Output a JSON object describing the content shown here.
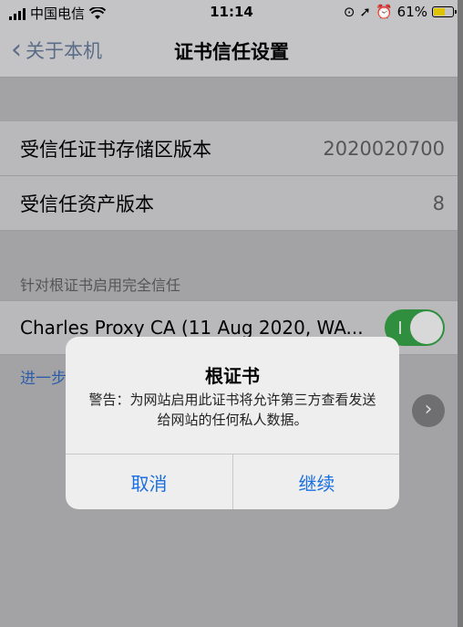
{
  "status_bar": {
    "carrier": "中国电信",
    "time": "11:14",
    "battery_percent": "61%",
    "battery_level": 0.61,
    "icons": [
      "signal-icon",
      "wifi-icon",
      "rotation-lock-icon",
      "location-icon",
      "alarm-icon",
      "battery-icon"
    ]
  },
  "nav": {
    "back_label": "关于本机",
    "title": "证书信任设置"
  },
  "rows": [
    {
      "label": "受信任证书存储区版本",
      "value": "2020020700"
    },
    {
      "label": "受信任资产版本",
      "value": "8"
    }
  ],
  "section_label": "针对根证书启用完全信任",
  "cert": {
    "name": "Charles Proxy CA (11 Aug 2020, WA...",
    "enabled": true
  },
  "more_link": "进一步",
  "alert": {
    "title": "根证书",
    "message": "警告：为网站启用此证书将允许第三方查看发送给网站的任何私人数据。",
    "cancel_label": "取消",
    "continue_label": "继续"
  },
  "colors": {
    "accent": "#1a6fe0",
    "toggle_on": "#2f8f3f"
  }
}
